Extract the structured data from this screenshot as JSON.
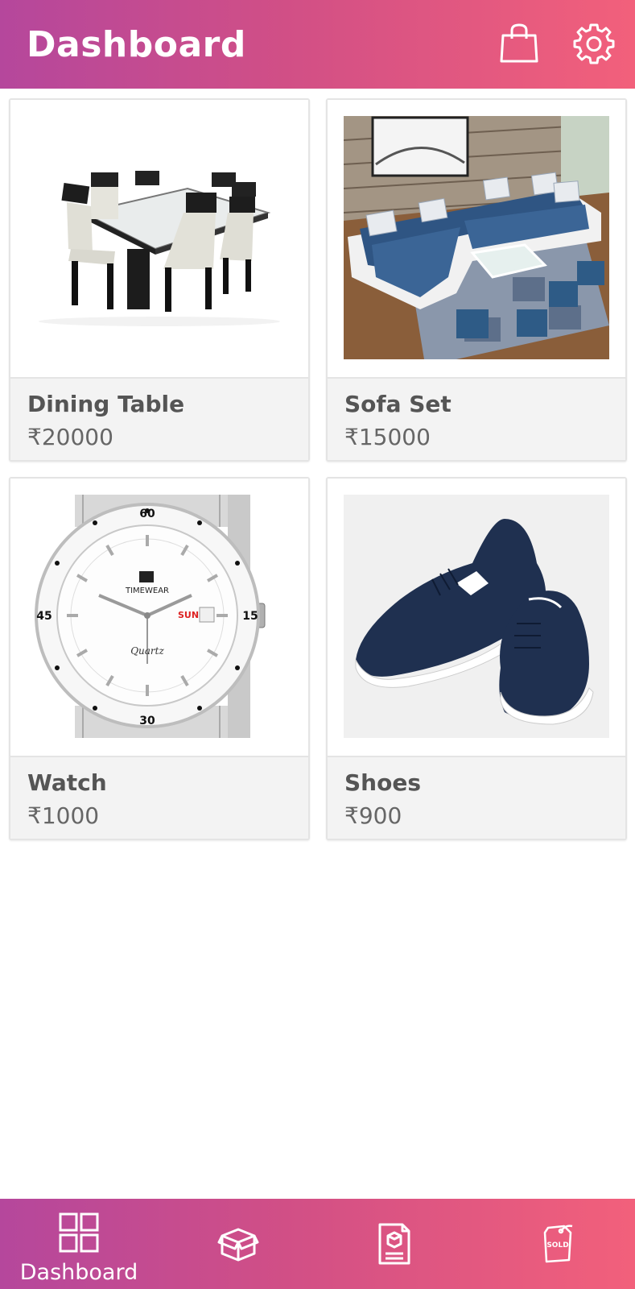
{
  "header": {
    "title": "Dashboard",
    "icons": [
      "shopping-bag-icon",
      "gear-icon"
    ]
  },
  "products": [
    {
      "name": "Dining Table",
      "price": "₹20000",
      "image": "dining-table-image"
    },
    {
      "name": "Sofa Set",
      "price": "₹15000",
      "image": "sofa-set-image"
    },
    {
      "name": "Watch",
      "price": "₹1000",
      "image": "watch-image"
    },
    {
      "name": "Shoes",
      "price": "₹900",
      "image": "shoes-image"
    }
  ],
  "watch_face": {
    "brand": "TIMEWEAR",
    "sub": "Quartz",
    "day": "SUN",
    "bezel": [
      "60",
      "15",
      "30",
      "45"
    ]
  },
  "bottom_nav": {
    "items": [
      {
        "label": "Dashboard",
        "icon": "grid-icon",
        "active": true
      },
      {
        "label": "",
        "icon": "box-icon",
        "active": false
      },
      {
        "label": "",
        "icon": "document-icon",
        "active": false
      },
      {
        "label": "",
        "icon": "sold-tag-icon",
        "active": false
      }
    ]
  },
  "colors": {
    "gradient_start": "#b5479c",
    "gradient_end": "#f2607b",
    "card_footer": "#f3f3f3",
    "text": "#555555"
  }
}
